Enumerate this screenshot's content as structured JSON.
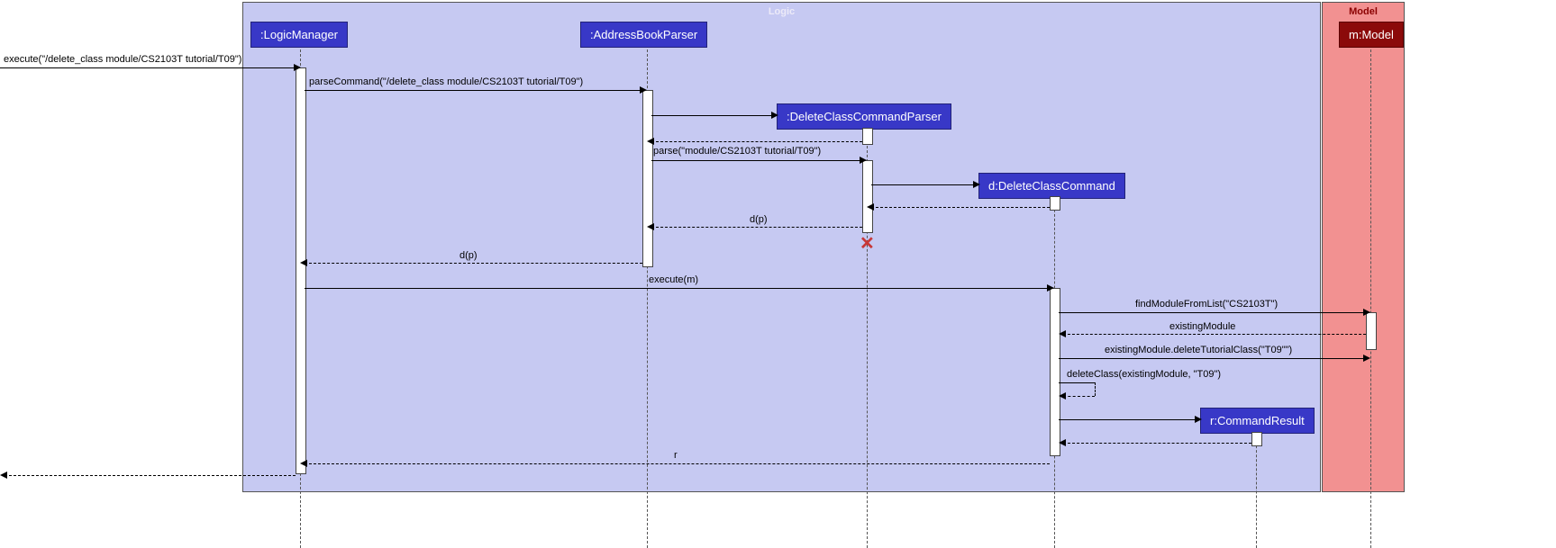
{
  "frames": {
    "logic_label": "Logic",
    "model_label": "Model"
  },
  "participants": {
    "logic_manager": ":LogicManager",
    "address_book_parser": ":AddressBookParser",
    "delete_class_command_parser": ":DeleteClassCommandParser",
    "delete_class_command": "d:DeleteClassCommand",
    "model": "m:Model",
    "command_result": "r:CommandResult"
  },
  "messages": {
    "m1": "execute(\"/delete_class module/CS2103T tutorial/T09\")",
    "m2": "parseCommand(\"/delete_class module/CS2103T tutorial/T09\")",
    "m3_return": "",
    "m4": "parse(\"module/CS2103T tutorial/T09\")",
    "m5_return": "",
    "m6": "d(p)",
    "m7": "d(p)",
    "m8": "execute(m)",
    "m9": "findModuleFromList(\"CS2103T\")",
    "m10": "existingModule",
    "m11": "existingModule.deleteTutorialClass(\"T09\"\")",
    "m12": "deleteClass(existingModule, \"T09\")",
    "m13_return": "",
    "m14": "r"
  }
}
